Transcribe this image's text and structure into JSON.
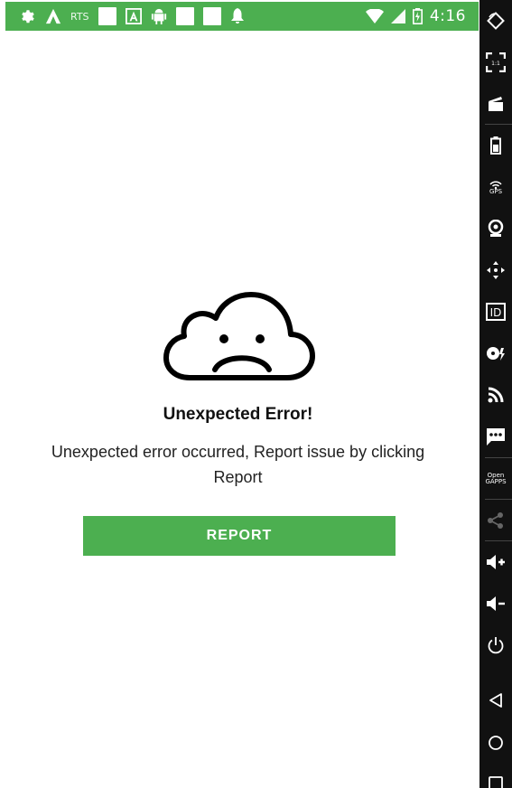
{
  "status_bar": {
    "left_icons": [
      "gear-icon",
      "app-a-icon",
      "rts-icon",
      "notification-square-icon",
      "text-a-icon",
      "android-icon",
      "notification-square-icon",
      "notification-square-icon",
      "bell-icon"
    ],
    "rts_label": "RTS",
    "time": "4:16",
    "right_icons": [
      "wifi-icon",
      "signal-icon",
      "battery-icon"
    ],
    "color": "#4caf50"
  },
  "error": {
    "icon": "sad-cloud-icon",
    "title": "Unexpected Error!",
    "message": "Unexpected error occurred, Report issue by clicking Report",
    "button_label": "REPORT",
    "button_color": "#4caf50"
  },
  "side_toolbar": {
    "items": [
      {
        "icon": "rotate-icon"
      },
      {
        "icon": "fullscreen-icon",
        "label": "1:1"
      },
      {
        "icon": "screen-record-icon"
      },
      {
        "icon": "battery-icon"
      },
      {
        "icon": "gps-icon",
        "label": "GPS"
      },
      {
        "icon": "webcam-icon"
      },
      {
        "icon": "dpad-icon"
      },
      {
        "icon": "device-id-icon",
        "label": "ID"
      },
      {
        "icon": "media-icon"
      },
      {
        "icon": "cast-icon"
      },
      {
        "icon": "sms-icon"
      },
      {
        "icon": "opengapps-icon",
        "label": "Open GAPPS"
      },
      {
        "icon": "share-icon"
      },
      {
        "icon": "volume-up-icon"
      },
      {
        "icon": "volume-down-icon"
      },
      {
        "icon": "power-icon"
      },
      {
        "icon": "back-icon"
      },
      {
        "icon": "home-icon"
      },
      {
        "icon": "recents-icon"
      }
    ]
  }
}
